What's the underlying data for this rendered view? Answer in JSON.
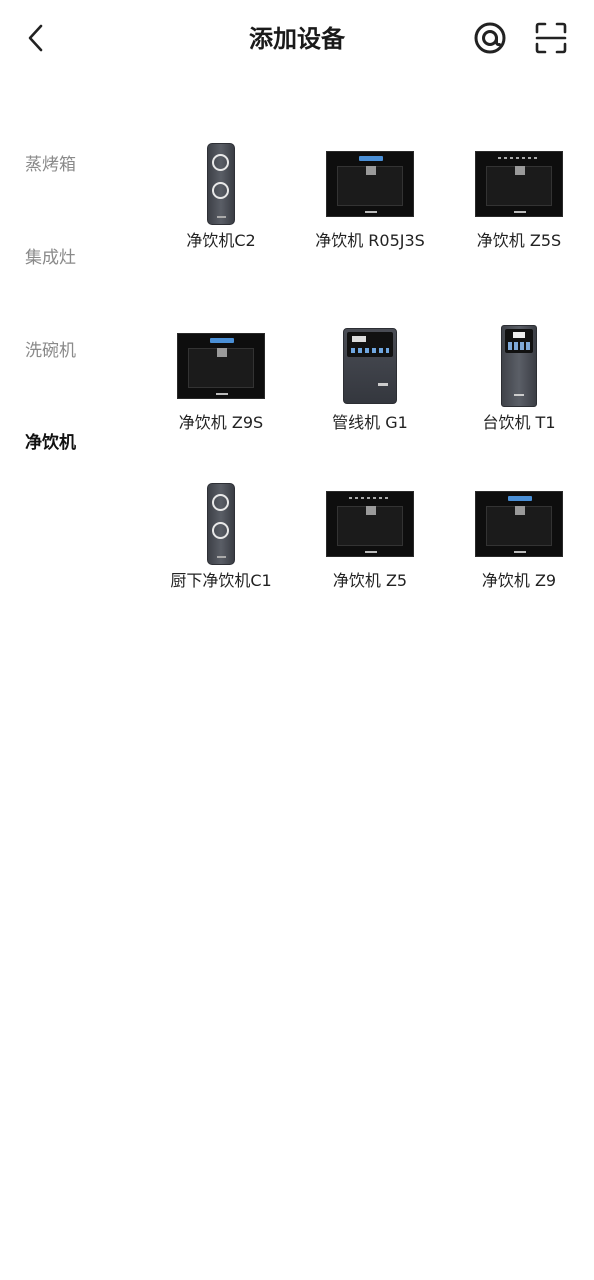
{
  "header": {
    "title": "添加设备",
    "back_icon": "chevron-left-icon",
    "nearby_icon": "at-sign-icon",
    "scan_icon": "scan-frame-icon"
  },
  "sidebar": {
    "items": [
      {
        "label": "蒸烤箱",
        "active": false
      },
      {
        "label": "集成灶",
        "active": false
      },
      {
        "label": "洗碗机",
        "active": false
      },
      {
        "label": "净饮机",
        "active": true
      }
    ]
  },
  "devices": [
    {
      "name": "净饮机C2",
      "image": "slim-undersink"
    },
    {
      "name": "净饮机 R05J3S",
      "image": "builtin-black"
    },
    {
      "name": "净饮机 Z5S",
      "image": "builtin-black"
    },
    {
      "name": "净饮机 Z9S",
      "image": "builtin-black"
    },
    {
      "name": "管线机 G1",
      "image": "pipeline-unit"
    },
    {
      "name": "台饮机 T1",
      "image": "tabletop-unit"
    },
    {
      "name": "厨下净饮机C1",
      "image": "slim-undersink"
    },
    {
      "name": "净饮机 Z5",
      "image": "builtin-black"
    },
    {
      "name": "净饮机 Z9",
      "image": "builtin-black"
    }
  ],
  "colors": {
    "active_text": "#111111",
    "inactive_text": "#8a8a8a",
    "screen_accent": "#4a8fd6"
  }
}
